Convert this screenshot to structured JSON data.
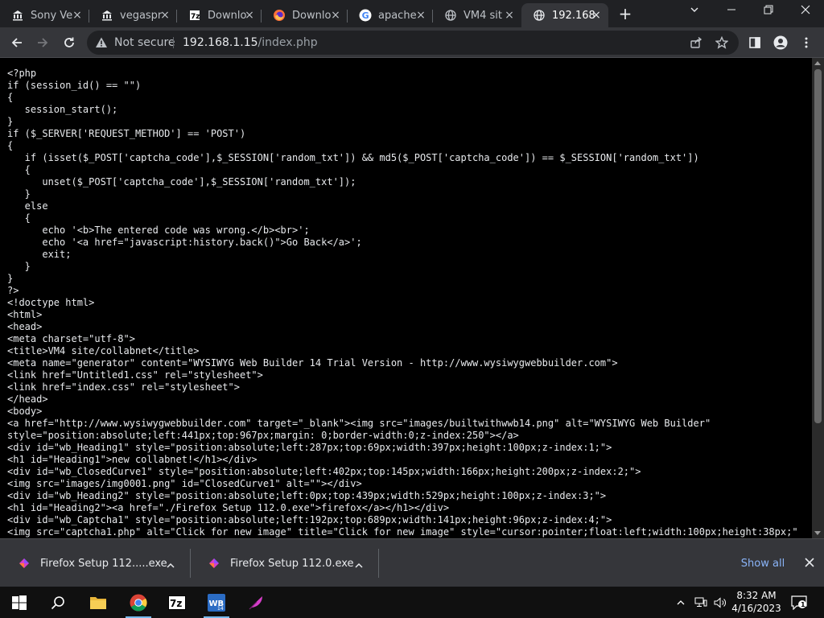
{
  "tabs": [
    {
      "label": "Sony Ve",
      "icon": "bank-icon"
    },
    {
      "label": "vegaspr",
      "icon": "bank-icon"
    },
    {
      "label": "Downlo",
      "icon": "7zip-icon"
    },
    {
      "label": "Downlo",
      "icon": "firefox-icon"
    },
    {
      "label": "apache",
      "icon": "google-icon"
    },
    {
      "label": "VM4 sit",
      "icon": "globe-icon"
    },
    {
      "label": "192.168",
      "icon": "globe-icon",
      "active": true
    }
  ],
  "toolbar": {
    "security_label": "Not secure",
    "url_host": "192.168.1.15",
    "url_path": "/index.php"
  },
  "source_lines": [
    "<?php",
    "if (session_id() == \"\")",
    "{",
    "   session_start();",
    "}",
    "if ($_SERVER['REQUEST_METHOD'] == 'POST')",
    "{",
    "   if (isset($_POST['captcha_code'],$_SESSION['random_txt']) && md5($_POST['captcha_code']) == $_SESSION['random_txt'])",
    "   {",
    "      unset($_POST['captcha_code'],$_SESSION['random_txt']);",
    "   }",
    "   else",
    "   {",
    "      echo '<b>The entered code was wrong.</b><br>';",
    "      echo '<a href=\"javascript:history.back()\">Go Back</a>';",
    "      exit;",
    "   }",
    "}",
    "?>",
    "<!doctype html>",
    "<html>",
    "<head>",
    "<meta charset=\"utf-8\">",
    "<title>VM4 site/collabnet</title>",
    "<meta name=\"generator\" content=\"WYSIWYG Web Builder 14 Trial Version - http://www.wysiwygwebbuilder.com\">",
    "<link href=\"Untitled1.css\" rel=\"stylesheet\">",
    "<link href=\"index.css\" rel=\"stylesheet\">",
    "</head>",
    "<body>",
    "<a href=\"http://www.wysiwygwebbuilder.com\" target=\"_blank\"><img src=\"images/builtwithwwb14.png\" alt=\"WYSIWYG Web Builder\"",
    "style=\"position:absolute;left:441px;top:967px;margin: 0;border-width:0;z-index:250\"></a>",
    "<div id=\"wb_Heading1\" style=\"position:absolute;left:287px;top:69px;width:397px;height:100px;z-index:1;\">",
    "<h1 id=\"Heading1\">new collabnet!</h1></div>",
    "<div id=\"wb_ClosedCurve1\" style=\"position:absolute;left:402px;top:145px;width:166px;height:200px;z-index:2;\">",
    "<img src=\"images/img0001.png\" id=\"ClosedCurve1\" alt=\"\"></div>",
    "<div id=\"wb_Heading2\" style=\"position:absolute;left:0px;top:439px;width:529px;height:100px;z-index:3;\">",
    "<h1 id=\"Heading2\"><a href=\"./Firefox Setup 112.0.exe\">firefox</a></h1></div>",
    "<div id=\"wb_Captcha1\" style=\"position:absolute;left:192px;top:689px;width:141px;height:96px;z-index:4;\">",
    "<img src=\"captcha1.php\" alt=\"Click for new image\" title=\"Click for new image\" style=\"cursor:pointer;float:left;width:100px;height:38px;\""
  ],
  "downloads": [
    {
      "name": "Firefox Setup 112.....exe"
    },
    {
      "name": "Firefox Setup 112.0.exe"
    }
  ],
  "downloads_show_all": "Show all",
  "taskbar": {
    "time": "8:32 AM",
    "date": "4/16/2023",
    "notification_count": "1"
  }
}
